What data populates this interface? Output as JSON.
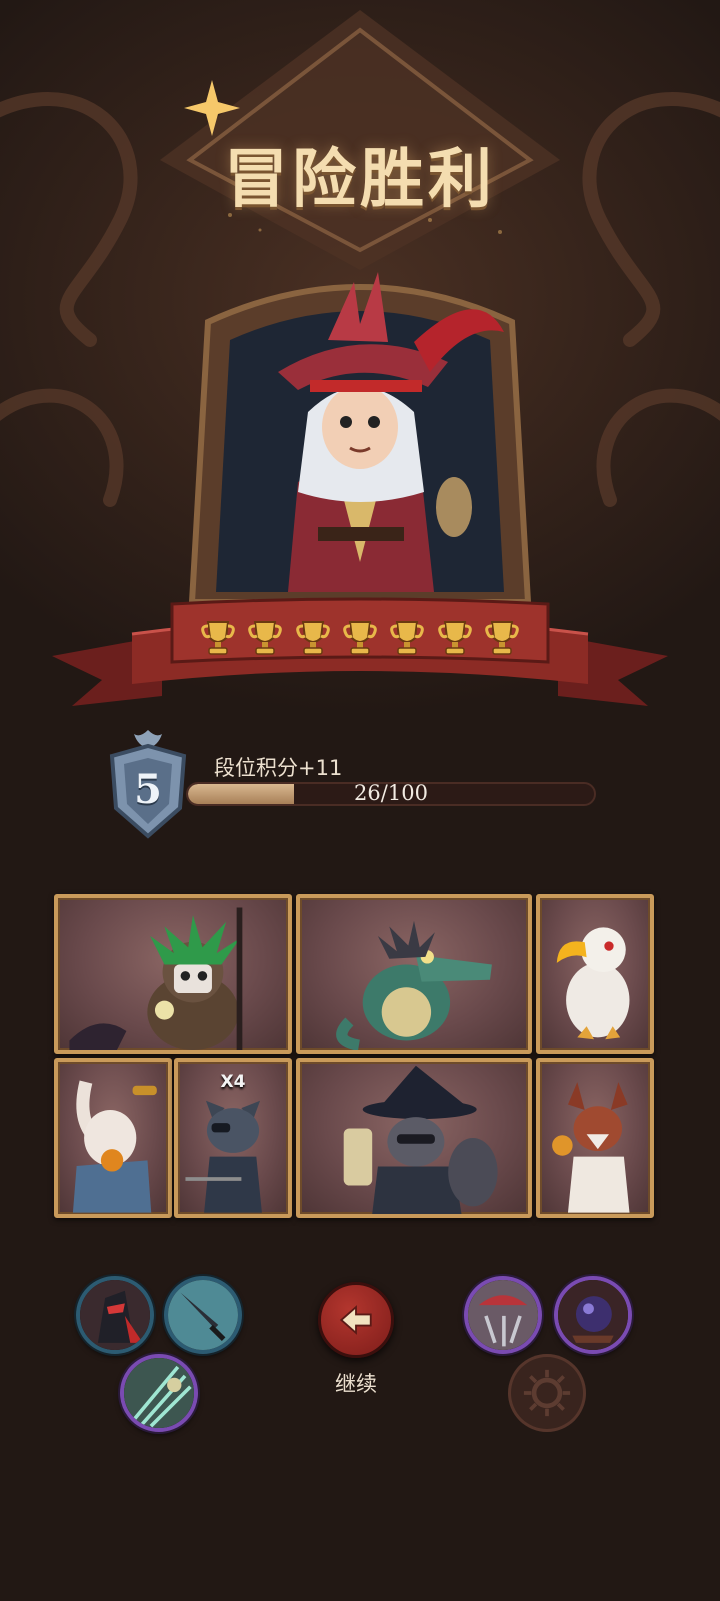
{
  "screen": {
    "title": "冒险胜利",
    "continue_label": "继续"
  },
  "hero": {
    "icon": "pirate-captain-portrait",
    "trophy_count": 7,
    "trophy_icon": "trophy-icon"
  },
  "rank": {
    "tier": "5",
    "points_label": "段位积分+11",
    "progress_text": "26/100",
    "progress_fraction": 0.26
  },
  "roster": {
    "row1": [
      {
        "icon": "witch-doctor-owl-portrait"
      },
      {
        "icon": "crocodile-warrior-portrait"
      },
      {
        "icon": "white-toucan-portrait"
      }
    ],
    "row2": [
      {
        "icon": "scarecrow-rabbit-portrait"
      },
      {
        "icon": "pirate-cat-portrait",
        "badge": "X4"
      },
      {
        "icon": "raccoon-wizard-portrait"
      },
      {
        "icon": "red-fox-portrait"
      }
    ]
  },
  "relics": {
    "left": [
      {
        "icon": "dark-knight-relic-icon",
        "rarity": "rare"
      },
      {
        "icon": "dagger-relic-icon",
        "rarity": "rare"
      },
      {
        "icon": "claw-slash-relic-icon",
        "rarity": "epic"
      }
    ],
    "right": [
      {
        "icon": "red-cap-relic-icon",
        "rarity": "epic"
      },
      {
        "icon": "purple-orb-relic-icon",
        "rarity": "epic"
      }
    ]
  },
  "colors": {
    "title_gold": "#f4ddb0",
    "banner_red": "#8c2b25",
    "frame_gold": "#c99a5a",
    "rare_blue": "#2c5b72",
    "epic_purple": "#7a4bb2",
    "continue_red": "#a52d27"
  }
}
